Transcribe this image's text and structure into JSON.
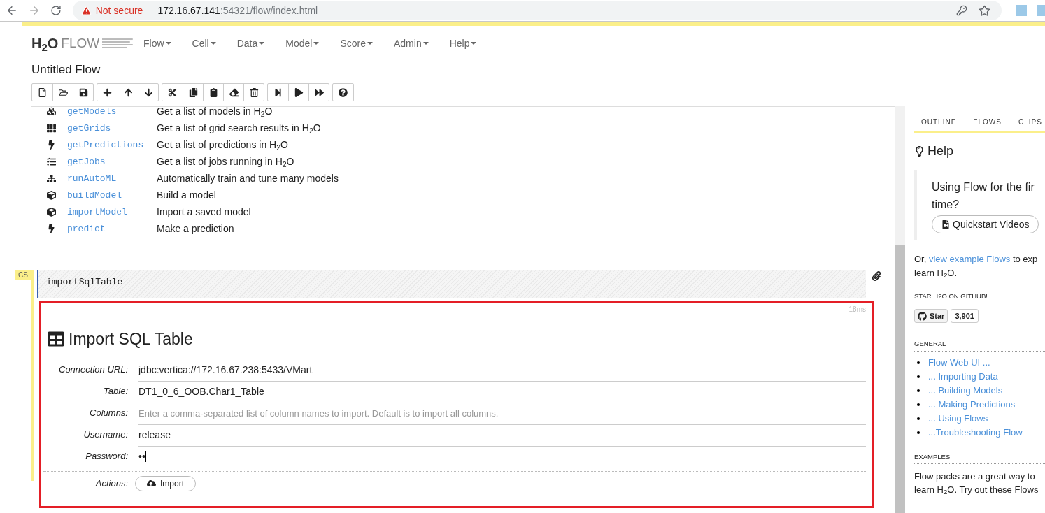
{
  "browser": {
    "security": "Not secure",
    "host": "172.16.67.141",
    "path": ":54321/flow/index.html"
  },
  "app": {
    "logo": "H$_{2}$O",
    "logo_word": "FLOW",
    "menu": [
      "Flow",
      "Cell",
      "Data",
      "Model",
      "Score",
      "Admin",
      "Help"
    ],
    "title": "Untitled Flow"
  },
  "commands": [
    {
      "name": "getModels",
      "description": "Get a list of models in H$_{2}$O"
    },
    {
      "name": "getGrids",
      "description": "Get a list of grid search results in H$_{2}$O"
    },
    {
      "name": "getPredictions",
      "description": "Get a list of predictions in H$_{2}$O"
    },
    {
      "name": "getJobs",
      "description": "Get a list of jobs running in H$_{2}$O"
    },
    {
      "name": "runAutoML",
      "description": "Automatically train and tune many models"
    },
    {
      "name": "buildModel",
      "description": "Build a model"
    },
    {
      "name": "importModel",
      "description": "Import a saved model"
    },
    {
      "name": "predict",
      "description": "Make a prediction"
    }
  ],
  "cell": {
    "type_label": "CS",
    "selected": true,
    "input": "importSqlTable",
    "time": "18ms",
    "output": {
      "title": "Import SQL Table",
      "fields": [
        {
          "label": "Connection URL:",
          "value": "jdbc:vertica://172.16.67.238:5433/VMart",
          "focused": false
        },
        {
          "label": "Table:",
          "value": "DT1_0_6_OOB.Char1_Table",
          "focused": false
        },
        {
          "label": "Columns:",
          "placeholder": "Enter a comma-separated list of column names to import. Default is to import all columns.",
          "focused": false
        },
        {
          "label": "Username:",
          "value": "release",
          "focused": false
        },
        {
          "label": "Password:",
          "value": "••",
          "focused": true
        }
      ],
      "actions_label": "Actions:",
      "action_button": "Import"
    }
  },
  "sidebar": {
    "tabs": [
      "OUTLINE",
      "FLOWS",
      "CLIPS"
    ],
    "help_title": "Help",
    "intro_lines": [
      "Using Flow for the fir",
      "time?"
    ],
    "quickstart_button": "Quickstart Videos",
    "note": {
      "before": "Or, ",
      "link": "view example Flows",
      "after": " to exp",
      "line2": "learn H$_{2}$O."
    },
    "github_heading": "STAR H2O ON GITHUB!",
    "star_button": "Star",
    "star_count": "3,901",
    "general_heading": "GENERAL",
    "general_links": [
      "Flow Web UI ...",
      "... Importing Data",
      "... Building Models",
      "... Making Predictions",
      "... Using Flows",
      "...Troubleshooting Flow"
    ],
    "examples_heading": "EXAMPLES",
    "examples_lines": [
      "Flow packs are a great way to",
      "learn H$_{2}$O. Try out these Flows"
    ]
  }
}
